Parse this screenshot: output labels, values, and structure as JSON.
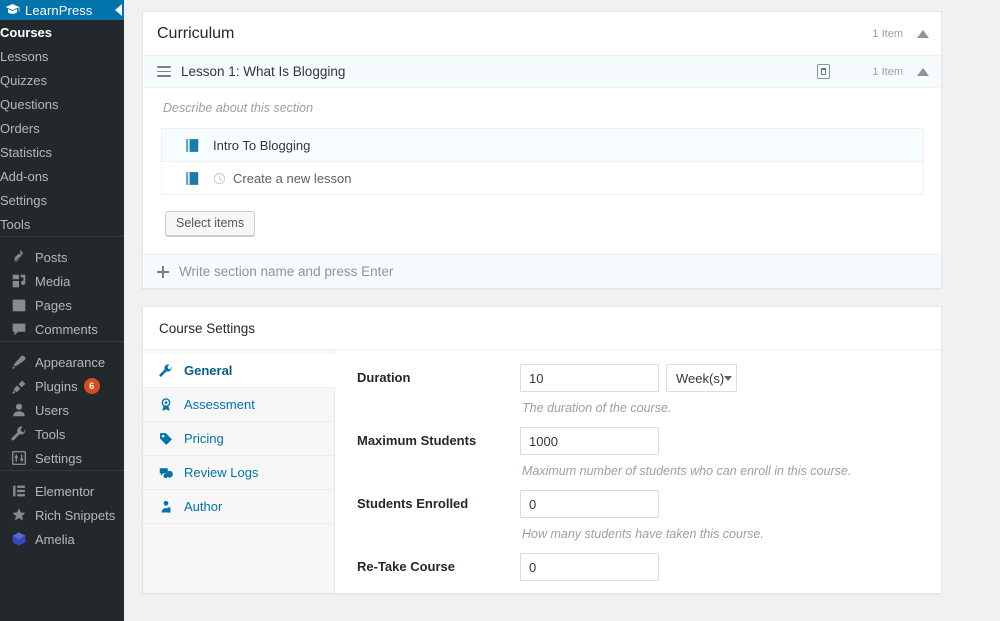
{
  "sidebar": {
    "brand": {
      "label": "LearnPress",
      "icon": "graduation-cap-icon",
      "color": "#0073aa",
      "collapse_icon": "collapse-left-arrow-icon"
    },
    "learnpress_items": [
      {
        "label": "Courses",
        "current": true
      },
      {
        "label": "Lessons",
        "current": false
      },
      {
        "label": "Quizzes",
        "current": false
      },
      {
        "label": "Questions",
        "current": false
      },
      {
        "label": "Orders",
        "current": false
      },
      {
        "label": "Statistics",
        "current": false
      },
      {
        "label": "Add-ons",
        "current": false
      },
      {
        "label": "Settings",
        "current": false
      },
      {
        "label": "Tools",
        "current": false
      }
    ],
    "wp_items": [
      {
        "label": "Posts",
        "icon": "pin-icon",
        "badge": ""
      },
      {
        "label": "Media",
        "icon": "media-icon",
        "badge": ""
      },
      {
        "label": "Pages",
        "icon": "page-icon",
        "badge": ""
      },
      {
        "label": "Comments",
        "icon": "comment-icon",
        "badge": ""
      }
    ],
    "wp_items2": [
      {
        "label": "Appearance",
        "icon": "brush-icon",
        "badge": ""
      },
      {
        "label": "Plugins",
        "icon": "plug-icon",
        "badge": "6"
      },
      {
        "label": "Users",
        "icon": "user-icon",
        "badge": ""
      },
      {
        "label": "Tools",
        "icon": "wrench-icon",
        "badge": ""
      },
      {
        "label": "Settings",
        "icon": "sliders-icon",
        "badge": ""
      }
    ],
    "plugin_items": [
      {
        "label": "Elementor",
        "icon": "elementor-icon",
        "badge": ""
      },
      {
        "label": "Rich Snippets",
        "icon": "star-icon",
        "badge": ""
      },
      {
        "label": "Amelia",
        "icon": "amelia-cube-icon",
        "badge": ""
      }
    ],
    "badge_color": "#d54e21"
  },
  "curriculum": {
    "title": "Curriculum",
    "item_count": "1 Item",
    "collapse_icon": "caret-up-icon",
    "section": {
      "drag_icon": "drag-handle-icon",
      "name": "Lesson 1: What Is Blogging",
      "remove_icon": "remove-section-icon",
      "item_count": "1 Item",
      "collapse_icon": "caret-up-icon",
      "description_placeholder": "Describe about this section",
      "items": [
        {
          "icon": "lesson-book-icon",
          "label": "Intro To Blogging",
          "selected": true,
          "pending": false
        },
        {
          "icon": "lesson-book-icon",
          "label": "Create a new lesson",
          "selected": false,
          "pending": true,
          "pending_icon": "clock-icon"
        }
      ],
      "select_items_label": "Select items"
    },
    "new_section_placeholder": "Write section name and press Enter",
    "new_section_icon": "plus-icon"
  },
  "course_settings": {
    "title": "Course Settings",
    "tabs": [
      {
        "label": "General",
        "icon": "wrench-icon",
        "active": true
      },
      {
        "label": "Assessment",
        "icon": "award-icon",
        "active": false
      },
      {
        "label": "Pricing",
        "icon": "tag-icon",
        "active": false
      },
      {
        "label": "Review Logs",
        "icon": "comments-icon",
        "active": false
      },
      {
        "label": "Author",
        "icon": "author-icon",
        "active": false
      }
    ],
    "accent_color": "#0073aa",
    "fields": [
      {
        "label": "Duration",
        "value": "10",
        "unit": "Week(s)",
        "has_unit": true,
        "description": "The duration of the course."
      },
      {
        "label": "Maximum Students",
        "value": "1000",
        "unit": "",
        "has_unit": false,
        "description": "Maximum number of students who can enroll in this course."
      },
      {
        "label": "Students Enrolled",
        "value": "0",
        "unit": "",
        "has_unit": false,
        "description": "How many students have taken this course."
      },
      {
        "label": "Re-Take Course",
        "value": "0",
        "unit": "",
        "has_unit": false,
        "description": ""
      }
    ]
  }
}
